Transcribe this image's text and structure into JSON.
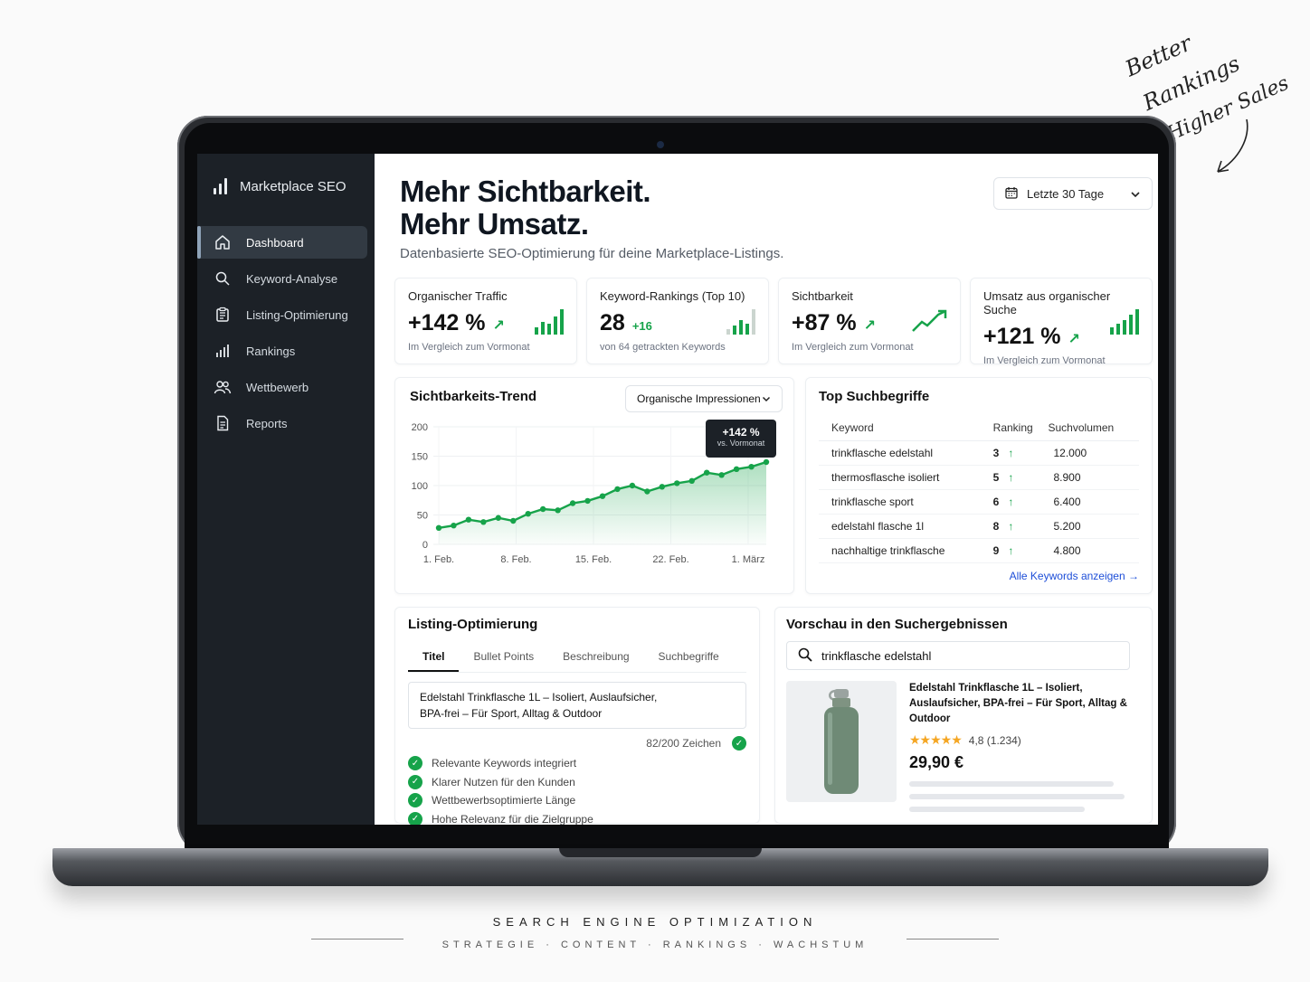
{
  "note": {
    "line1": "Better",
    "line2": "Rankings",
    "line3": "Higher Sales"
  },
  "sidebar": {
    "brand": "Marketplace SEO",
    "items": [
      {
        "label": "Dashboard",
        "icon": "home-icon"
      },
      {
        "label": "Keyword-Analyse",
        "icon": "search-icon"
      },
      {
        "label": "Listing-Optimierung",
        "icon": "clipboard-icon"
      },
      {
        "label": "Rankings",
        "icon": "bar-chart-icon"
      },
      {
        "label": "Wettbewerb",
        "icon": "users-icon"
      },
      {
        "label": "Reports",
        "icon": "document-icon"
      }
    ]
  },
  "hero": {
    "title_line1": "Mehr Sichtbarkeit.",
    "title_line2": "Mehr Umsatz.",
    "subtitle": "Datenbasierte SEO-Optimierung für deine Marketplace-Listings."
  },
  "date_range": "Letzte 30 Tage",
  "kpis": [
    {
      "label": "Organischer Traffic",
      "value": "+142 %",
      "delta": "",
      "note": "Im Vergleich zum Vormonat"
    },
    {
      "label": "Keyword-Rankings (Top 10)",
      "value": "28",
      "delta": "+16",
      "note": "von 64 getrackten Keywords"
    },
    {
      "label": "Sichtbarkeit",
      "value": "+87 %",
      "delta": "",
      "note": "Im Vergleich zum Vormonat"
    },
    {
      "label": "Umsatz aus organischer Suche",
      "value": "+121 %",
      "delta": "",
      "note": "Im Vergleich zum Vormonat"
    }
  ],
  "trend": {
    "title": "Sichtbarkeits-Trend",
    "select": "Organische Impressionen",
    "tooltip_value": "+142 %",
    "tooltip_note": "vs. Vormonat"
  },
  "chart_data": {
    "type": "area",
    "x_labels": [
      "1. Feb.",
      "8. Feb.",
      "15. Feb.",
      "22. Feb.",
      "1. März"
    ],
    "yticks": [
      0,
      50,
      100,
      150,
      200
    ],
    "ylim": [
      0,
      200
    ],
    "values": [
      28,
      32,
      42,
      38,
      45,
      40,
      52,
      60,
      58,
      70,
      74,
      82,
      94,
      100,
      90,
      98,
      104,
      108,
      122,
      118,
      128,
      132,
      140
    ],
    "accent": "#16a34a"
  },
  "top_keywords": {
    "title": "Top Suchbegriffe",
    "headers": [
      "Keyword",
      "Ranking",
      "Suchvolumen"
    ],
    "rows": [
      {
        "keyword": "trinkflasche edelstahl",
        "rank": "3",
        "volume": "12.000"
      },
      {
        "keyword": "thermosflasche isoliert",
        "rank": "5",
        "volume": "8.900"
      },
      {
        "keyword": "trinkflasche sport",
        "rank": "6",
        "volume": "6.400"
      },
      {
        "keyword": "edelstahl flasche 1l",
        "rank": "8",
        "volume": "5.200"
      },
      {
        "keyword": "nachhaltige trinkflasche",
        "rank": "9",
        "volume": "4.800"
      }
    ],
    "link": "Alle Keywords anzeigen"
  },
  "listing": {
    "title": "Listing-Optimierung",
    "tabs": [
      "Titel",
      "Bullet Points",
      "Beschreibung",
      "Suchbegriffe"
    ],
    "title_line1": "Edelstahl Trinkflasche 1L – Isoliert, Auslaufsicher,",
    "title_line2": "BPA-frei – Für Sport, Alltag & Outdoor",
    "char_count": "82/200 Zeichen",
    "checks": [
      "Relevante Keywords integriert",
      "Klarer Nutzen für den Kunden",
      "Wettbewerbsoptimierte Länge",
      "Hohe Relevanz für die Zielgruppe"
    ]
  },
  "serp": {
    "title": "Vorschau in den Suchergebnissen",
    "query": "trinkflasche edelstahl",
    "result_line1": "Edelstahl Trinkflasche 1L – Isoliert,",
    "result_line2": "Auslaufsicher, BPA-frei – Für Sport, Alltag & Outdoor",
    "stars": "★★★★★",
    "rating": "4,8 (1.234)",
    "price": "29,90 €"
  },
  "caption": {
    "main": "SEARCH ENGINE OPTIMIZATION",
    "sub": "STRATEGIE · CONTENT · RANKINGS · WACHSTUM"
  }
}
